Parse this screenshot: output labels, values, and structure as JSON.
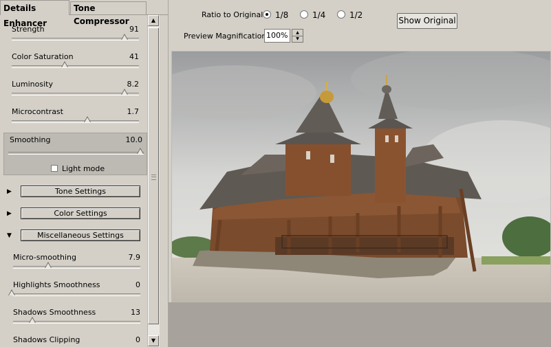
{
  "tabs": [
    {
      "label": "Details Enhancer",
      "active": true
    },
    {
      "label": "Tone Compressor",
      "active": false
    }
  ],
  "sliders": [
    {
      "label": "Strength",
      "value": "91",
      "fraction": 0.91
    },
    {
      "label": "Color Saturation",
      "value": "41",
      "fraction": 0.41
    },
    {
      "label": "Luminosity",
      "value": "8.2",
      "fraction": 0.91
    },
    {
      "label": "Microcontrast",
      "value": "1.7",
      "fraction": 0.6
    }
  ],
  "smoothing": {
    "label": "Smoothing",
    "value": "10.0",
    "fraction": 1.0,
    "light_mode_label": "Light mode",
    "light_mode_checked": false
  },
  "sections": [
    {
      "label": "Tone Settings",
      "expanded": false
    },
    {
      "label": "Color Settings",
      "expanded": false
    },
    {
      "label": "Miscellaneous Settings",
      "expanded": true
    }
  ],
  "misc_sliders": [
    {
      "label": "Micro-smoothing",
      "value": "7.9",
      "fraction": 0.26
    },
    {
      "label": "Highlights Smoothness",
      "value": "0",
      "fraction": 0.0
    },
    {
      "label": "Shadows Smoothness",
      "value": "13",
      "fraction": 0.13
    },
    {
      "label": "Shadows Clipping",
      "value": "0",
      "fraction": 0.0
    }
  ],
  "preview": {
    "ratio_label": "Ratio to Original:",
    "ratios": [
      {
        "label": "1/8",
        "selected": true
      },
      {
        "label": "1/4",
        "selected": false
      },
      {
        "label": "1/2",
        "selected": false
      }
    ],
    "show_original_label": "Show Original",
    "magnification_label": "Preview Magnification:",
    "magnification_value": "100%"
  },
  "colors": {
    "panel": "#d4d0c8",
    "bottom_area": "#a7a39c"
  }
}
